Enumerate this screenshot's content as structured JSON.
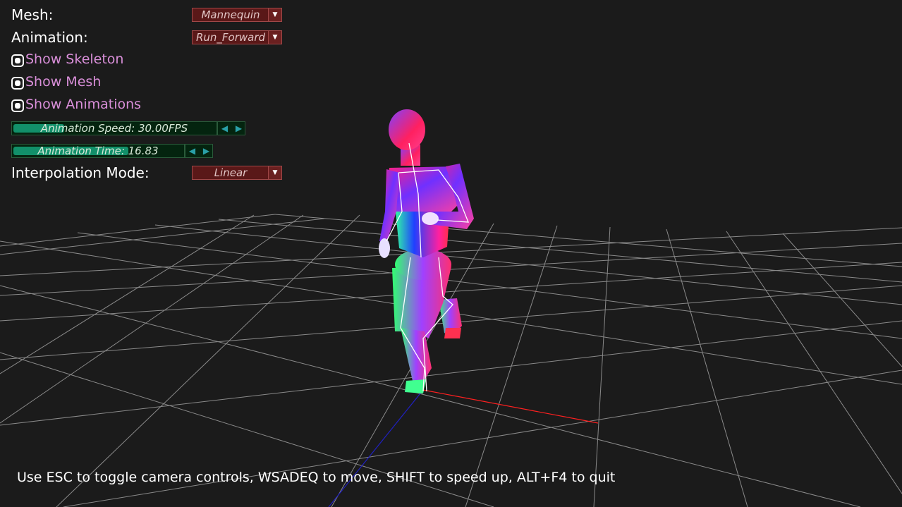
{
  "mesh": {
    "label": "Mesh:",
    "value": "Mannequin"
  },
  "animation": {
    "label": "Animation:",
    "value": "Run_Forward"
  },
  "checkboxes": [
    {
      "label": "Show Skeleton",
      "checked": true
    },
    {
      "label": "Show Mesh",
      "checked": true
    },
    {
      "label": "Show Animations",
      "checked": true
    }
  ],
  "speed_slider": {
    "text": "Animation Speed: 30.00FPS",
    "fill_fraction": 0.25
  },
  "time_slider": {
    "text": "Animation Time: 16.83",
    "fill_fraction": 0.68
  },
  "interpolation": {
    "label": "Interpolation Mode:",
    "value": "Linear"
  },
  "help_text": "Use ESC to toggle camera controls, WSADEQ to move, SHIFT to speed up, ALT+F4 to quit",
  "colors": {
    "background": "#1b1b1b",
    "dropdown": "#5a1818",
    "checkbox_label": "#d98fd9",
    "slider_fill": "#12906a",
    "axis_x": "#ff2020",
    "axis_z": "#2020c0",
    "grid": "#8a8a8a"
  },
  "icons": {
    "dropdown_arrow": "chevron-down-icon",
    "step_left": "triangle-left-icon",
    "step_right": "triangle-right-icon"
  }
}
